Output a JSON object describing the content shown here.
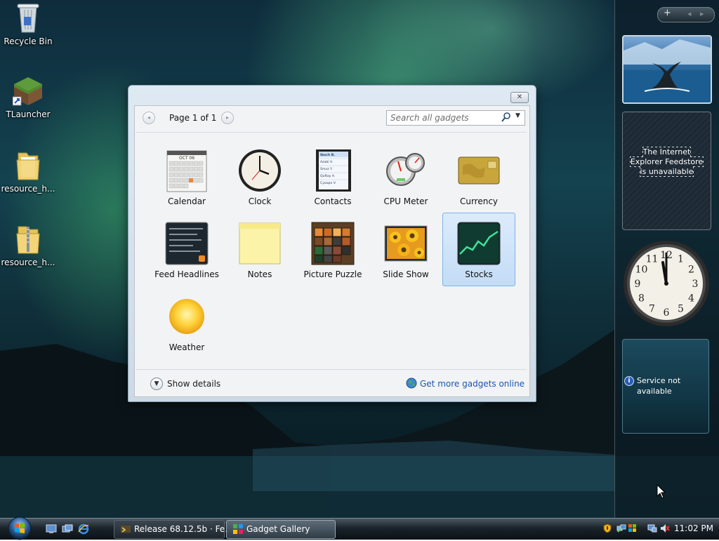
{
  "desktop": {
    "icons": [
      {
        "label": "Recycle Bin"
      },
      {
        "label": "TLauncher"
      },
      {
        "label": "resource_h..."
      },
      {
        "label": "resource_h..."
      }
    ]
  },
  "sidebar": {
    "controls": {
      "add": "+",
      "prev": "◂",
      "next": "▸"
    },
    "feed_message": "The Internet Explorer Feedstore is unavailable",
    "clock_numbers": [
      "12",
      "1",
      "2",
      "3",
      "4",
      "5",
      "6",
      "7",
      "8",
      "9",
      "10",
      "11"
    ],
    "weather_message": "Service not available"
  },
  "gallery": {
    "close_glyph": "✕",
    "pager": {
      "label": "Page 1 of 1",
      "prev": "◂",
      "next": "▸"
    },
    "search": {
      "placeholder": "Search all gadgets"
    },
    "gadgets": [
      {
        "label": "Calendar",
        "selected": false
      },
      {
        "label": "Clock",
        "selected": false
      },
      {
        "label": "Contacts",
        "selected": false
      },
      {
        "label": "CPU Meter",
        "selected": false
      },
      {
        "label": "Currency",
        "selected": false
      },
      {
        "label": "Feed Headlines",
        "selected": false
      },
      {
        "label": "Notes",
        "selected": false
      },
      {
        "label": "Picture Puzzle",
        "selected": false
      },
      {
        "label": "Slide Show",
        "selected": false
      },
      {
        "label": "Stocks",
        "selected": true
      },
      {
        "label": "Weather",
        "selected": false
      }
    ],
    "thumb_text": {
      "calendar_month": "OCT 06",
      "contacts_names": [
        "Iboch B.",
        "Azabi V.",
        "Smuz Y.",
        "Quftay A.",
        "Cyoope V."
      ]
    },
    "show_details": "Show details",
    "more_online": "Get more gadgets online"
  },
  "taskbar": {
    "buttons": [
      {
        "label": "Release 68.12.5b · Fe...",
        "active": false
      },
      {
        "label": "Gadget Gallery",
        "active": true
      }
    ],
    "clock": "11:02 PM"
  },
  "colors": {
    "link": "#1a56b0",
    "selection": "#c3dcf6",
    "taskbar": "#1a232a"
  }
}
